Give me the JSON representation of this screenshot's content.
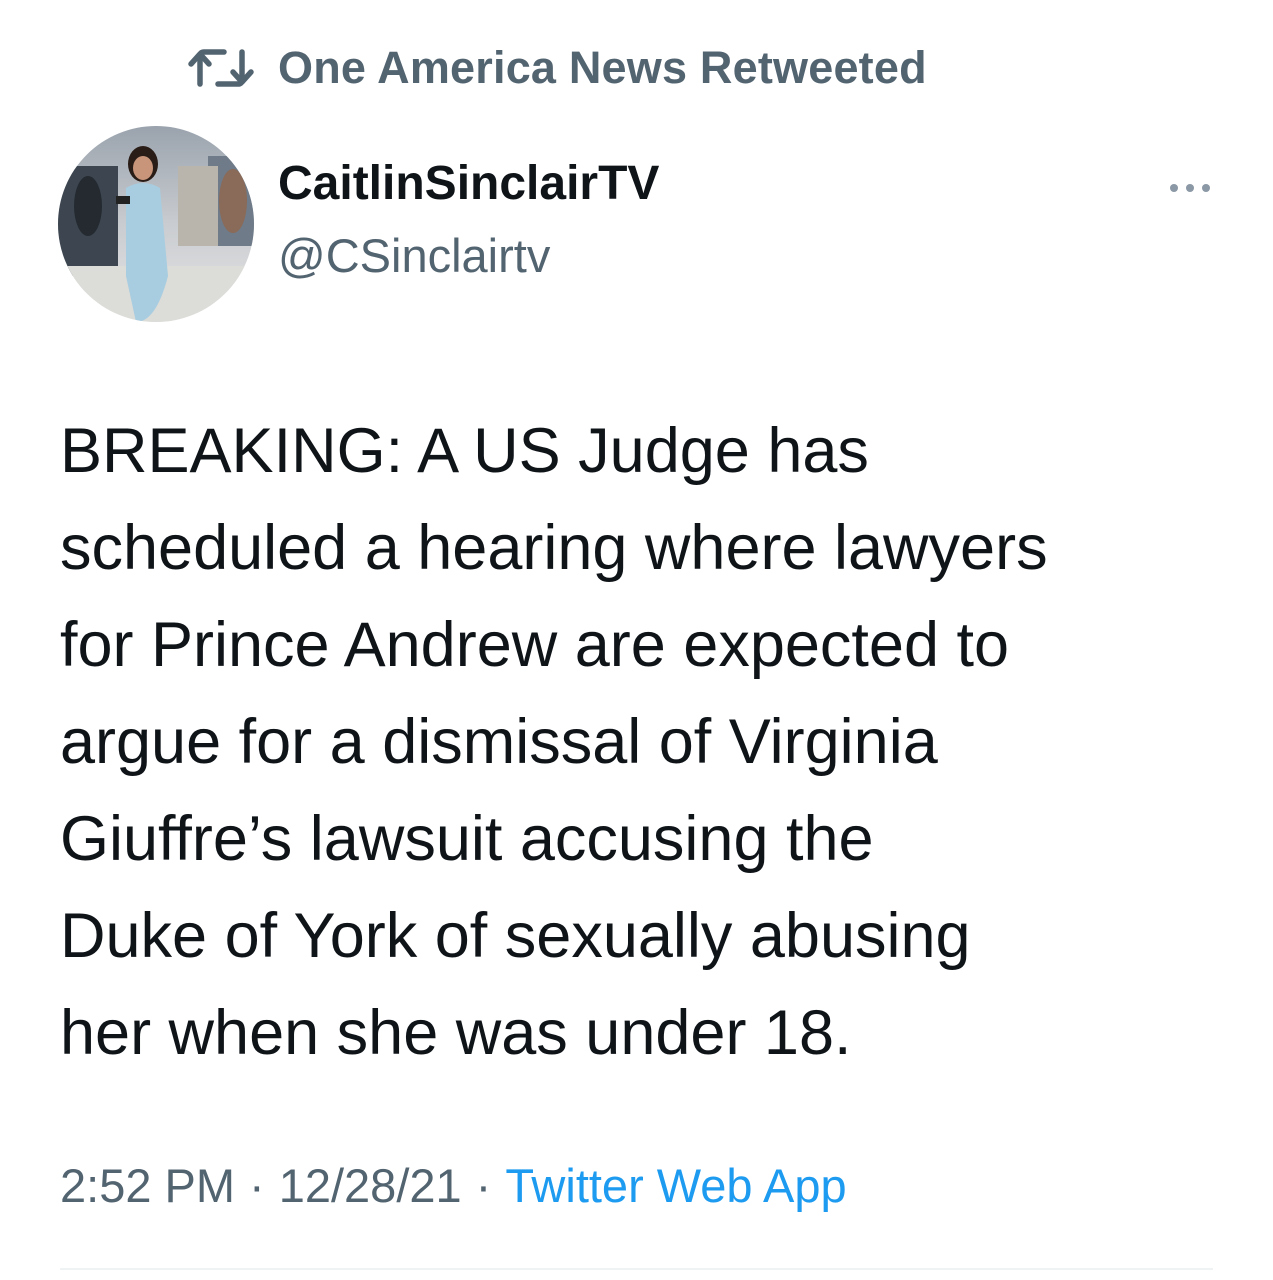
{
  "retweet": {
    "icon": "retweet-icon",
    "label": "One America News Retweeted"
  },
  "author": {
    "avatar_icon": "avatar",
    "display_name": "CaitlinSinclairTV",
    "handle": "@CSinclairtv"
  },
  "more_icon": "more-horizontal-icon",
  "tweet": {
    "lines": [
      "BREAKING: A US Judge has",
      "scheduled a hearing where lawyers",
      "for Prince Andrew are expected to",
      "argue for a dismissal of Virginia",
      "Giuffre’s lawsuit accusing the",
      "Duke of York of sexually abusing",
      "her when she was under 18."
    ]
  },
  "meta": {
    "time": "2:52 PM",
    "separator": "·",
    "date": "12/28/21",
    "source": "Twitter Web App"
  },
  "colors": {
    "text_primary": "#0f1419",
    "text_secondary": "#536471",
    "link": "#1d9bf0",
    "divider": "#eff3f4"
  }
}
